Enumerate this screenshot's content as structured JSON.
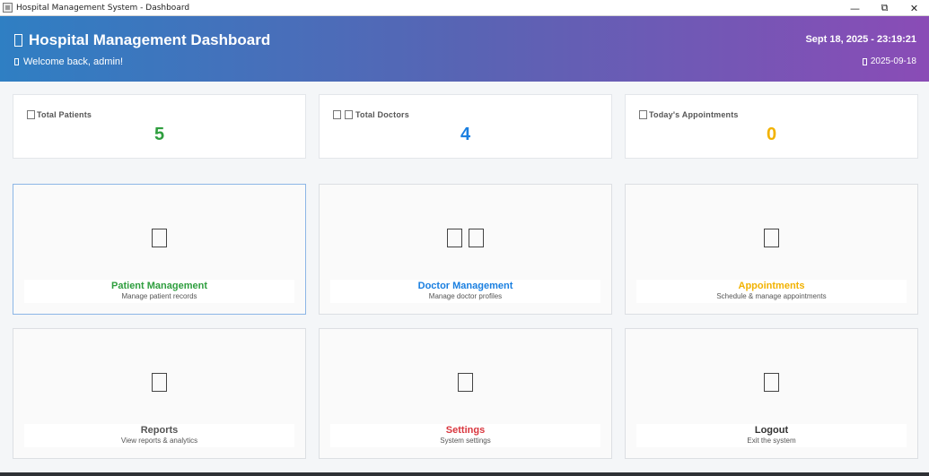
{
  "window": {
    "title": "Hospital Management System - Dashboard",
    "controls": {
      "minimize": "—",
      "restore": "⧉",
      "close": "✕"
    }
  },
  "header": {
    "title": "Hospital Management Dashboard",
    "welcome": "Welcome back, admin!",
    "datetime": "Sept 18, 2025 - 23:19:21",
    "date_short": "2025-09-18",
    "gradient": [
      "#2f7fc3",
      "#5864b4",
      "#8a4cb6"
    ]
  },
  "stats": [
    {
      "label": "Total Patients",
      "value": "5",
      "color": "#2e9e3e",
      "icon": "patient-icon"
    },
    {
      "label": "Total Doctors",
      "value": "4",
      "color": "#1a7fe0",
      "icon": "doctor-icon"
    },
    {
      "label": "Today's Appointments",
      "value": "0",
      "color": "#f2b200",
      "icon": "calendar-icon"
    }
  ],
  "tiles": [
    {
      "title": "Patient Management",
      "desc": "Manage patient records",
      "color": "#2e9e3e",
      "icon": "patient-icon"
    },
    {
      "title": "Doctor Management",
      "desc": "Manage doctor profiles",
      "color": "#1a7fe0",
      "icon": "doctor-icon"
    },
    {
      "title": "Appointments",
      "desc": "Schedule & manage appointments",
      "color": "#f2b200",
      "icon": "calendar-icon"
    },
    {
      "title": "Reports",
      "desc": "View reports & analytics",
      "color": "#555555",
      "icon": "chart-icon"
    },
    {
      "title": "Settings",
      "desc": "System settings",
      "color": "#d9363e",
      "icon": "gear-icon"
    },
    {
      "title": "Logout",
      "desc": "Exit the system",
      "color": "#333333",
      "icon": "logout-icon"
    }
  ]
}
